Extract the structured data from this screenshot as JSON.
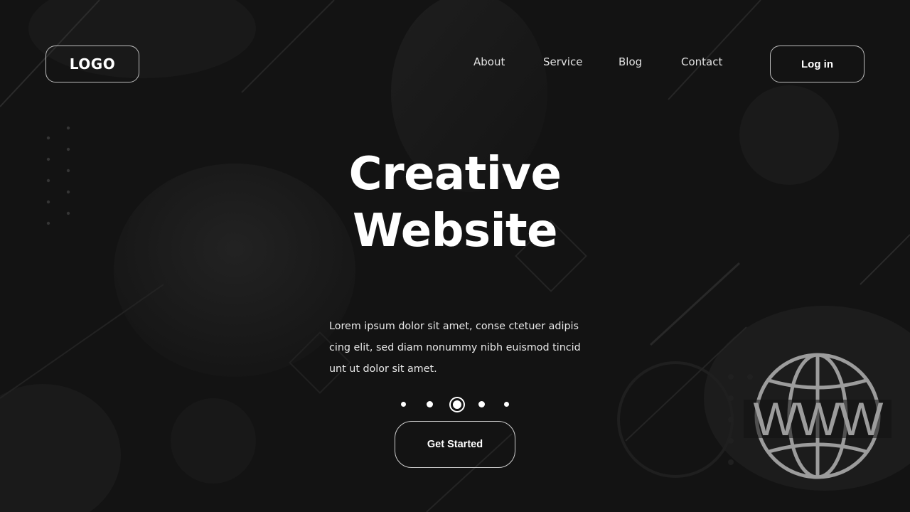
{
  "header": {
    "logo_label": "LOGO",
    "nav": [
      {
        "label": "About"
      },
      {
        "label": "Service"
      },
      {
        "label": "Blog"
      },
      {
        "label": "Contact"
      }
    ],
    "login_label": "Log in"
  },
  "hero": {
    "title_line1": "Creative",
    "title_line2": "Website",
    "description_lines": [
      "Lorem ipsum dolor sit amet, conse ctetuer adipis",
      "cing elit, sed diam nonummy nibh euismod tincid",
      "unt ut dolor sit amet."
    ],
    "carousel": {
      "count": 5,
      "active_index": 2
    },
    "cta_label": "Get Started"
  },
  "watermark": {
    "icon": "www-globe-icon",
    "text": "WWW"
  },
  "colors": {
    "background": "#131313",
    "text": "#ffffff",
    "border": "#bdbdbd",
    "watermark": "#9a9a9a"
  }
}
